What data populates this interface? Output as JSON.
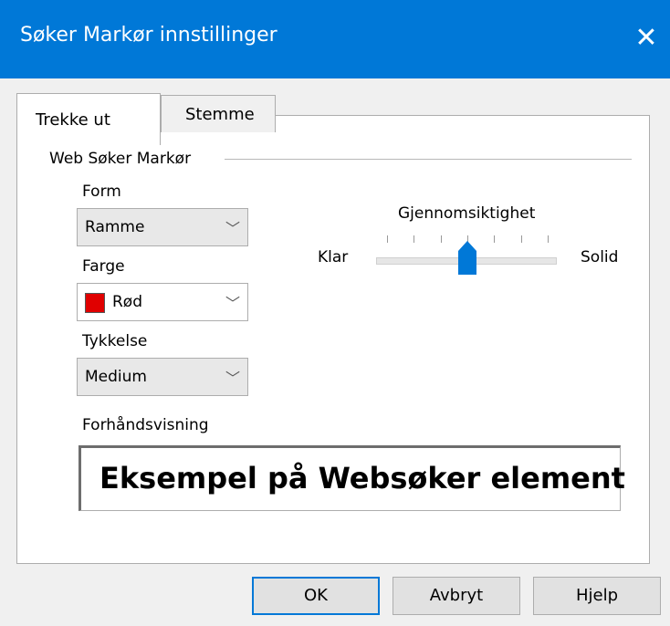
{
  "window": {
    "title": "Søker Markør innstillinger"
  },
  "tabs": [
    {
      "label": "Trekke ut"
    },
    {
      "label": "Stemme"
    }
  ],
  "group": {
    "title": "Web Søker Markør"
  },
  "form": {
    "label": "Form",
    "value": "Ramme"
  },
  "farge": {
    "label": "Farge",
    "value": "Rød",
    "color": "#e00000"
  },
  "tykkelse": {
    "label": "Tykkelse",
    "value": "Medium"
  },
  "slider": {
    "title": "Gjennomsiktighet",
    "min_label": "Klar",
    "max_label": "Solid",
    "value_fraction": 0.5,
    "tick_count": 7
  },
  "preview": {
    "label": "Forhåndsvisning",
    "text": "Eksempel på Websøker element"
  },
  "buttons": {
    "ok": "OK",
    "cancel": "Avbryt",
    "help": "Hjelp"
  },
  "colors": {
    "titlebar": "#0078d7",
    "accent": "#0078d7"
  }
}
